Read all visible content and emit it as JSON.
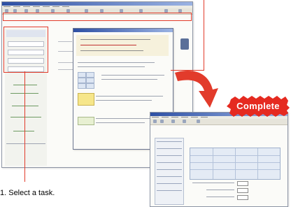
{
  "badge": {
    "label": "Complete",
    "color": "#e52a20"
  },
  "caption": {
    "label": "1. Select a task."
  },
  "icons": {
    "arrow": "curved-arrow-icon",
    "callout": "red-callout-icon"
  },
  "colors": {
    "accent": "#e23b2b",
    "titlebar": "#2d4fa3",
    "grid": "#a7b6cf"
  }
}
